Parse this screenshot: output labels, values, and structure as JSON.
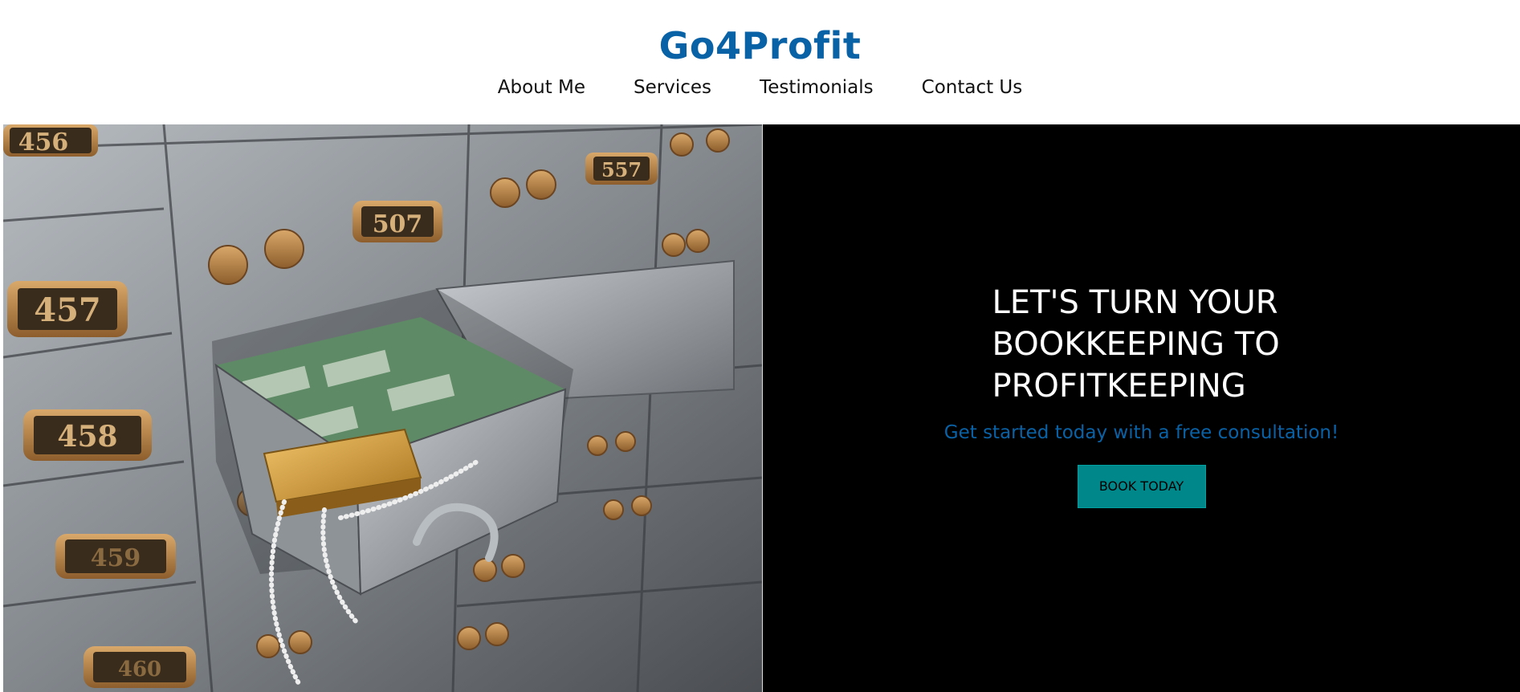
{
  "brand": {
    "title": "Go4Profit",
    "color": "#0a62a6"
  },
  "nav": {
    "items": [
      {
        "label": "About Me"
      },
      {
        "label": "Services"
      },
      {
        "label": "Testimonials"
      },
      {
        "label": "Contact Us"
      }
    ]
  },
  "hero": {
    "image": {
      "alt": "safe-deposit-boxes-image",
      "box_numbers": [
        "456",
        "507",
        "557",
        "457",
        "458",
        "459",
        "460"
      ]
    },
    "headline_lines": [
      "LET'S TURN YOUR",
      "BOOKKEEPING TO",
      "PROFITKEEPING"
    ],
    "subtitle": "Get started today with a free consultation!",
    "cta_label": "BOOK TODAY",
    "colors": {
      "panel_bg": "#000000",
      "headline": "#ffffff",
      "subtitle": "#0a62a6",
      "cta_bg": "#00878a"
    }
  }
}
